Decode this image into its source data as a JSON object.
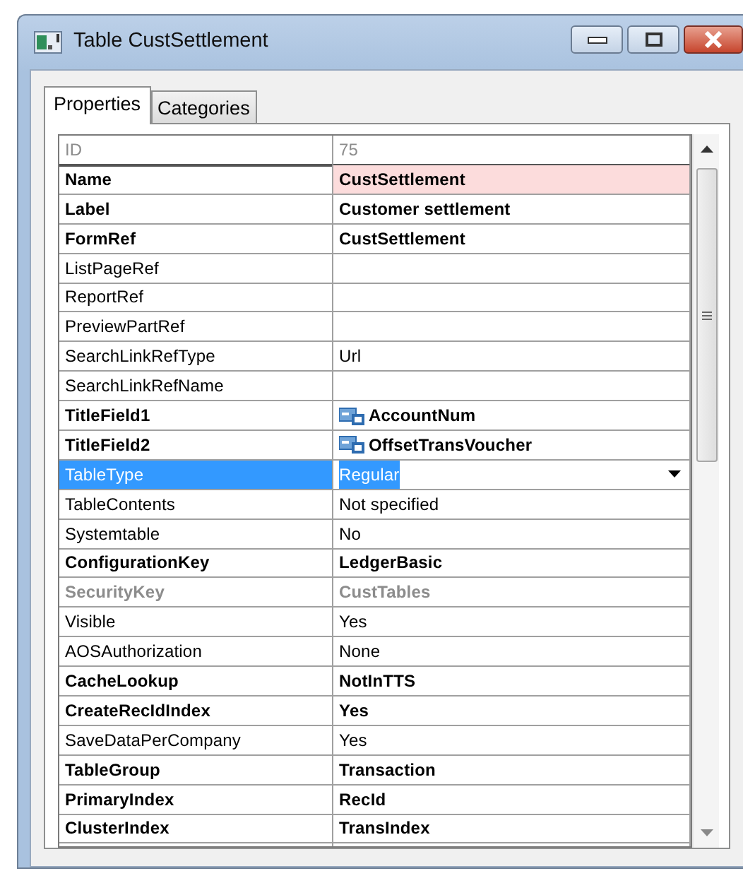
{
  "window": {
    "title": "Table CustSettlement"
  },
  "tabs": [
    {
      "label": "Properties",
      "selected": true
    },
    {
      "label": "Categories",
      "selected": false
    }
  ],
  "properties": [
    {
      "name": "ID",
      "value": "75",
      "kind": "disabled",
      "selected": false,
      "highlighted": false
    },
    {
      "name": "Name",
      "value": "CustSettlement",
      "kind": "bold",
      "selected": false,
      "highlighted": true
    },
    {
      "name": "Label",
      "value": "Customer settlement",
      "kind": "bold",
      "selected": false,
      "highlighted": false
    },
    {
      "name": "FormRef",
      "value": "CustSettlement",
      "kind": "bold",
      "selected": false,
      "highlighted": false
    },
    {
      "name": "ListPageRef",
      "kind": "normal",
      "selected": false,
      "highlighted": false
    },
    {
      "name": "ReportRef",
      "kind": "normal",
      "selected": false,
      "highlighted": false
    },
    {
      "name": "PreviewPartRef",
      "kind": "normal",
      "selected": false,
      "highlighted": false
    },
    {
      "name": "SearchLinkRefType",
      "value": "Url",
      "kind": "normal",
      "selected": false,
      "highlighted": false
    },
    {
      "name": "SearchLinkRefName",
      "kind": "normal",
      "selected": false,
      "highlighted": false
    },
    {
      "name": "TitleField1",
      "value": "AccountNum",
      "kind": "bold",
      "selected": false,
      "highlighted": false,
      "field_icon": true
    },
    {
      "name": "TitleField2",
      "value": "OffsetTransVoucher",
      "kind": "bold",
      "selected": false,
      "highlighted": false,
      "field_icon": true
    },
    {
      "name": "TableType",
      "value": "Regular",
      "kind": "normal",
      "selected": true,
      "highlighted": false,
      "dropdown": true
    },
    {
      "name": "TableContents",
      "value": "Not specified",
      "kind": "normal",
      "selected": false,
      "highlighted": false
    },
    {
      "name": "Systemtable",
      "value": "No",
      "kind": "normal",
      "selected": false,
      "highlighted": false
    },
    {
      "name": "ConfigurationKey",
      "value": "LedgerBasic",
      "kind": "bold",
      "selected": false,
      "highlighted": false
    },
    {
      "name": "SecurityKey",
      "value": "CustTables",
      "kind": "disabled-bold",
      "selected": false,
      "highlighted": false
    },
    {
      "name": "Visible",
      "value": "Yes",
      "kind": "normal",
      "selected": false,
      "highlighted": false
    },
    {
      "name": "AOSAuthorization",
      "value": "None",
      "kind": "normal",
      "selected": false,
      "highlighted": false
    },
    {
      "name": "CacheLookup",
      "value": "NotInTTS",
      "kind": "bold",
      "selected": false,
      "highlighted": false
    },
    {
      "name": "CreateRecIdIndex",
      "value": "Yes",
      "kind": "bold",
      "selected": false,
      "highlighted": false
    },
    {
      "name": "SaveDataPerCompany",
      "value": "Yes",
      "kind": "normal",
      "selected": false,
      "highlighted": false
    },
    {
      "name": "TableGroup",
      "value": "Transaction",
      "kind": "bold",
      "selected": false,
      "highlighted": false
    },
    {
      "name": "PrimaryIndex",
      "value": "RecId",
      "kind": "bold",
      "selected": false,
      "highlighted": false
    },
    {
      "name": "ClusterIndex",
      "value": "TransIndex",
      "kind": "bold",
      "selected": false,
      "highlighted": false
    }
  ]
}
